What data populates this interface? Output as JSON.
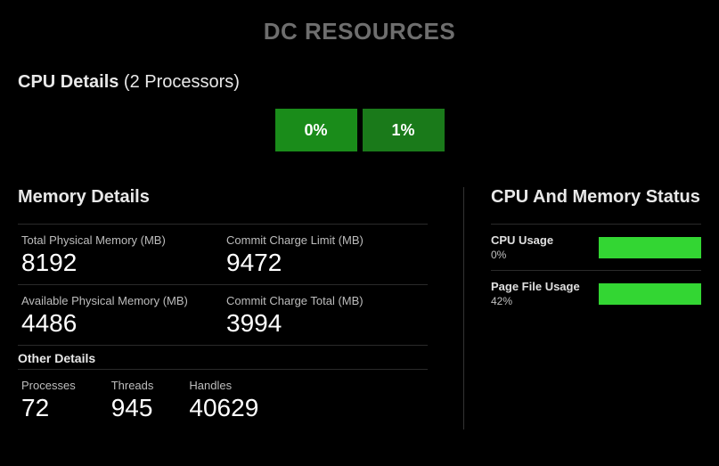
{
  "title": "DC RESOURCES",
  "cpu_details": {
    "heading_bold": "CPU Details",
    "heading_rest": " (2 Processors)",
    "tiles": [
      "0%",
      "1%"
    ]
  },
  "memory": {
    "heading": "Memory Details",
    "total_physical": {
      "label": "Total Physical Memory (MB)",
      "value": "8192"
    },
    "commit_limit": {
      "label": "Commit Charge Limit (MB)",
      "value": "9472"
    },
    "avail_physical": {
      "label": "Available Physical Memory (MB)",
      "value": "4486"
    },
    "commit_total": {
      "label": "Commit Charge Total (MB)",
      "value": "3994"
    },
    "other_heading": "Other Details",
    "processes": {
      "label": "Processes",
      "value": "72"
    },
    "threads": {
      "label": "Threads",
      "value": "945"
    },
    "handles": {
      "label": "Handles",
      "value": "40629"
    }
  },
  "status": {
    "heading": "CPU And Memory Status",
    "cpu_usage": {
      "label": "CPU Usage",
      "value": "0%",
      "bar_color": "#33d633"
    },
    "page_file": {
      "label": "Page File Usage",
      "value": "42%",
      "bar_color": "#33d633"
    }
  }
}
